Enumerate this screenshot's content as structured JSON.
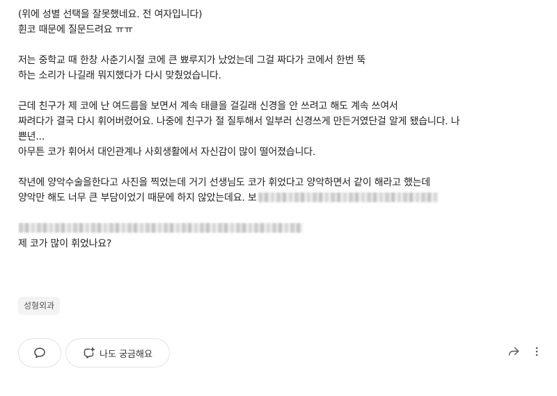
{
  "post": {
    "para1": {
      "line1": "(위에 성별 선택을 잘못했네요. 전 여자입니다)",
      "line2": "휜코 때문에 질문드려요 ㅠㅠ"
    },
    "para2": {
      "line1": "저는 중학교 때 한창 사춘기시절 코에 큰 뾰루지가 났었는데 그걸 짜다가 코에서 한번 뚝",
      "line2": "하는 소리가 나길래 뭐지했다가 다시 맞췄었습니다."
    },
    "para3": {
      "line1": "근데 친구가 제 코에 난 여드름을 보면서 계속 태클을 걸길래 신경을 안 쓰려고 해도 계속 쓰여서",
      "line2": "짜려다가 결국 다시 휘어버렸어요. 나중에 친구가 절 질투해서 일부러 신경쓰게 만든거였단걸 알게 됐습니다. 나",
      "line3": "쁜년...",
      "line4": "아무튼 코가 휘어서 대인관계나 사회생활에서 자신감이 많이 떨어졌습니다."
    },
    "para4": {
      "line1": "작년에 양악수술을한다고 사진을 찍었는데 거기 선생님도 코가 휘었다고 양악하면서 같이 해라고 했는데",
      "line2": "양악만 해도 너무 큰 부담이었기 때문에 하지 않았는데요. 보"
    },
    "para5": {
      "line2": "제 코가 많이 휘었나요?"
    }
  },
  "tag": "성형외과",
  "actions": {
    "comment_icon": "speech-bubble-icon",
    "curious_icon": "plus-bubble-icon",
    "curious_label": "나도 궁금해요",
    "share_icon": "share-arrow-icon",
    "more_icon": "vertical-dots-icon"
  },
  "colors": {
    "text": "#222222",
    "tag_bg": "#f3f3f3",
    "border": "#e3e3e3",
    "icon": "#555555"
  }
}
